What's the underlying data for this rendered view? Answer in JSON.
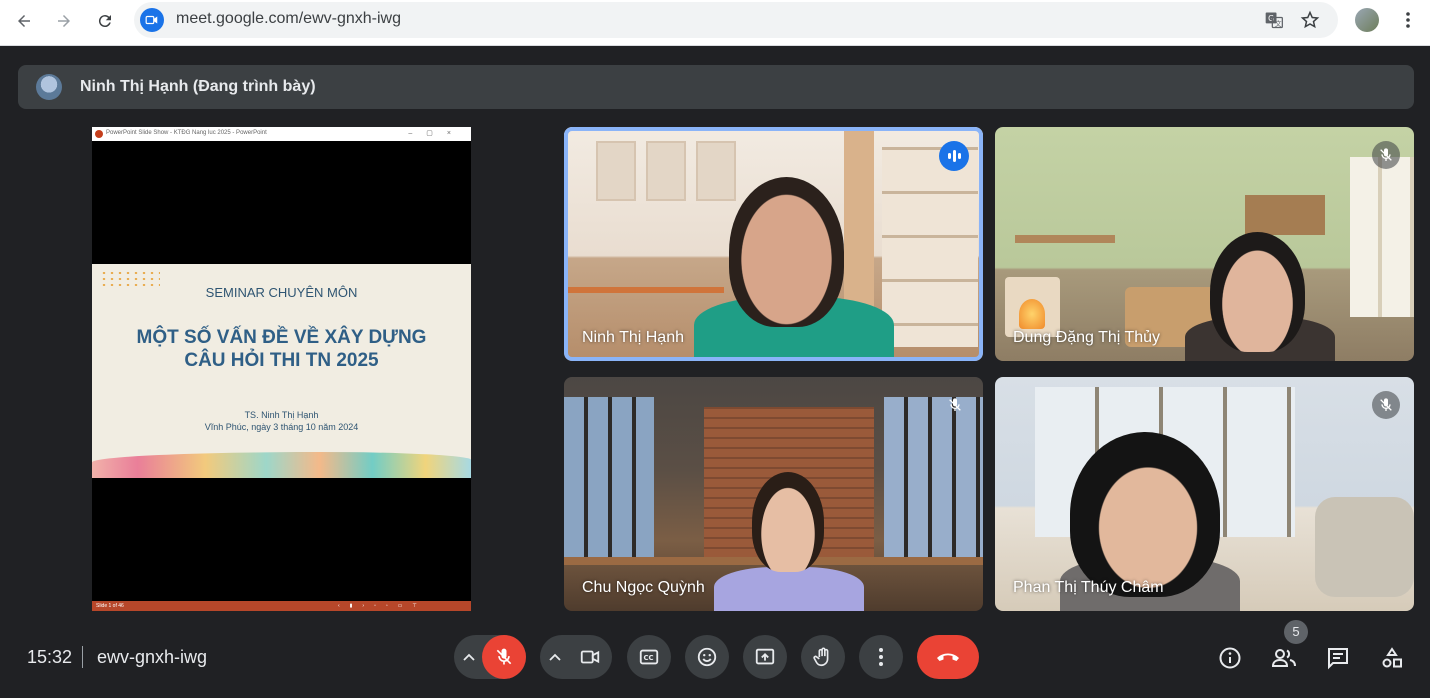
{
  "browser": {
    "url": "meet.google.com/ewv-gnxh-iwg"
  },
  "presenter": {
    "label": "Ninh Thị Hạnh (Đang trình bày)"
  },
  "slide": {
    "window_title": "PowerPoint Slide Show  -  KTĐG Nang luc 2025  -  PowerPoint",
    "subtitle": "SEMINAR CHUYÊN MÔN",
    "title_line1": "MỘT SỐ VẤN ĐỀ VỀ XÂY DỰNG",
    "title_line2": "CÂU HỎI THI TN 2025",
    "author": "TS. Ninh Thị Hạnh",
    "place_date": "Vĩnh Phúc, ngày 3 tháng 10 năm 2024",
    "status": "Slide 1 of 46"
  },
  "participants": [
    {
      "name": "Ninh Thị Hạnh",
      "state": "speaking"
    },
    {
      "name": "Dung Đặng Thị Thủy",
      "state": "muted"
    },
    {
      "name": "Chu Ngọc Quỳnh",
      "state": "muted"
    },
    {
      "name": "Phan Thị Thúy Châm",
      "state": "muted"
    }
  ],
  "bottom_bar": {
    "time": "15:32",
    "meeting_code": "ewv-gnxh-iwg",
    "people_count": "5"
  },
  "colors": {
    "background": "#202124",
    "tile_bg": "#3c4043",
    "leave_red": "#ea4335",
    "accent_blue": "#1a73e8",
    "speaking_border": "#8ab4f8"
  }
}
